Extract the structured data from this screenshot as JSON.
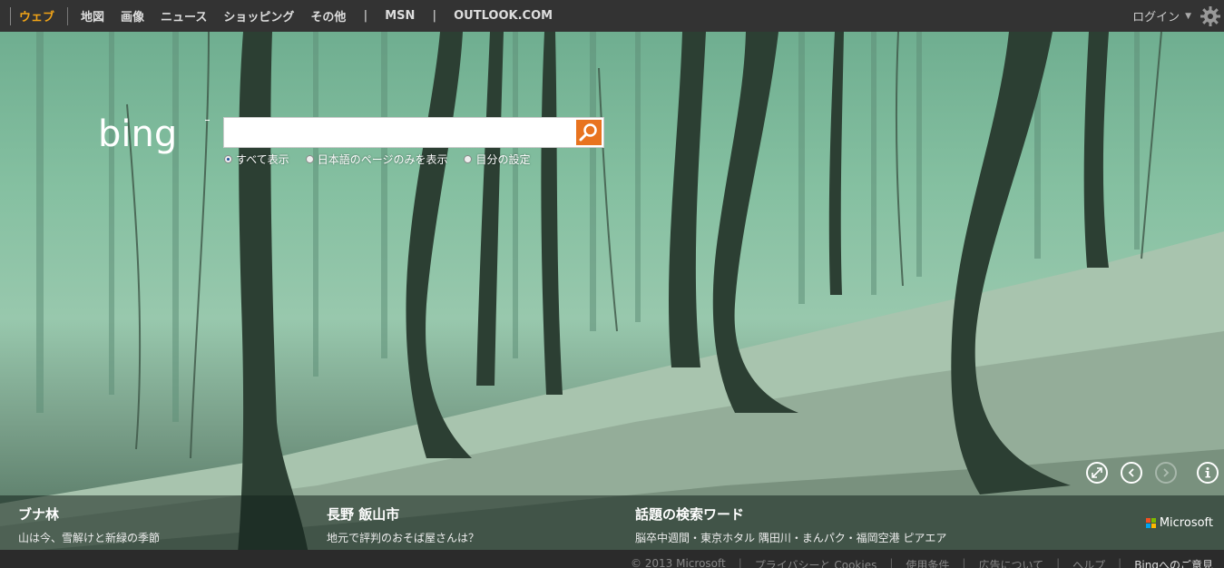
{
  "nav": {
    "items": [
      "ウェブ",
      "地図",
      "画像",
      "ニュース",
      "ショッピング",
      "その他"
    ],
    "pipe": "|",
    "msn": "MSN",
    "outlook": "OUTLOOK.COM",
    "login": "ログイン"
  },
  "logo_text": "bing",
  "search": {
    "value": "",
    "options": [
      "すべて表示",
      "日本語のページのみを表示",
      "目分の設定"
    ]
  },
  "band": {
    "col1": {
      "title": "ブナ林",
      "sub": "山は今、雪解けと新緑の季節"
    },
    "col2": {
      "title": "長野 飯山市",
      "sub": "地元で評判のおそば屋さんは？"
    },
    "col3": {
      "title": "話題の検索ワード",
      "sub": "脳卒中週間・東京ホタル 隅田川・まんパク・福岡空港 ピアエア"
    },
    "brand": "Microsoft"
  },
  "footer": {
    "items": [
      "© 2013 Microsoft",
      "プライバシーと Cookies",
      "使用条件",
      "広告について",
      "ヘルプ"
    ],
    "last": "Bingへのご意見"
  },
  "colors": {
    "accent": "#f1a417",
    "search_button": "#e8731f"
  },
  "icons": [
    "gear-icon",
    "search-icon",
    "expand-icon",
    "chevron-left-icon",
    "chevron-right-icon",
    "info-icon"
  ]
}
